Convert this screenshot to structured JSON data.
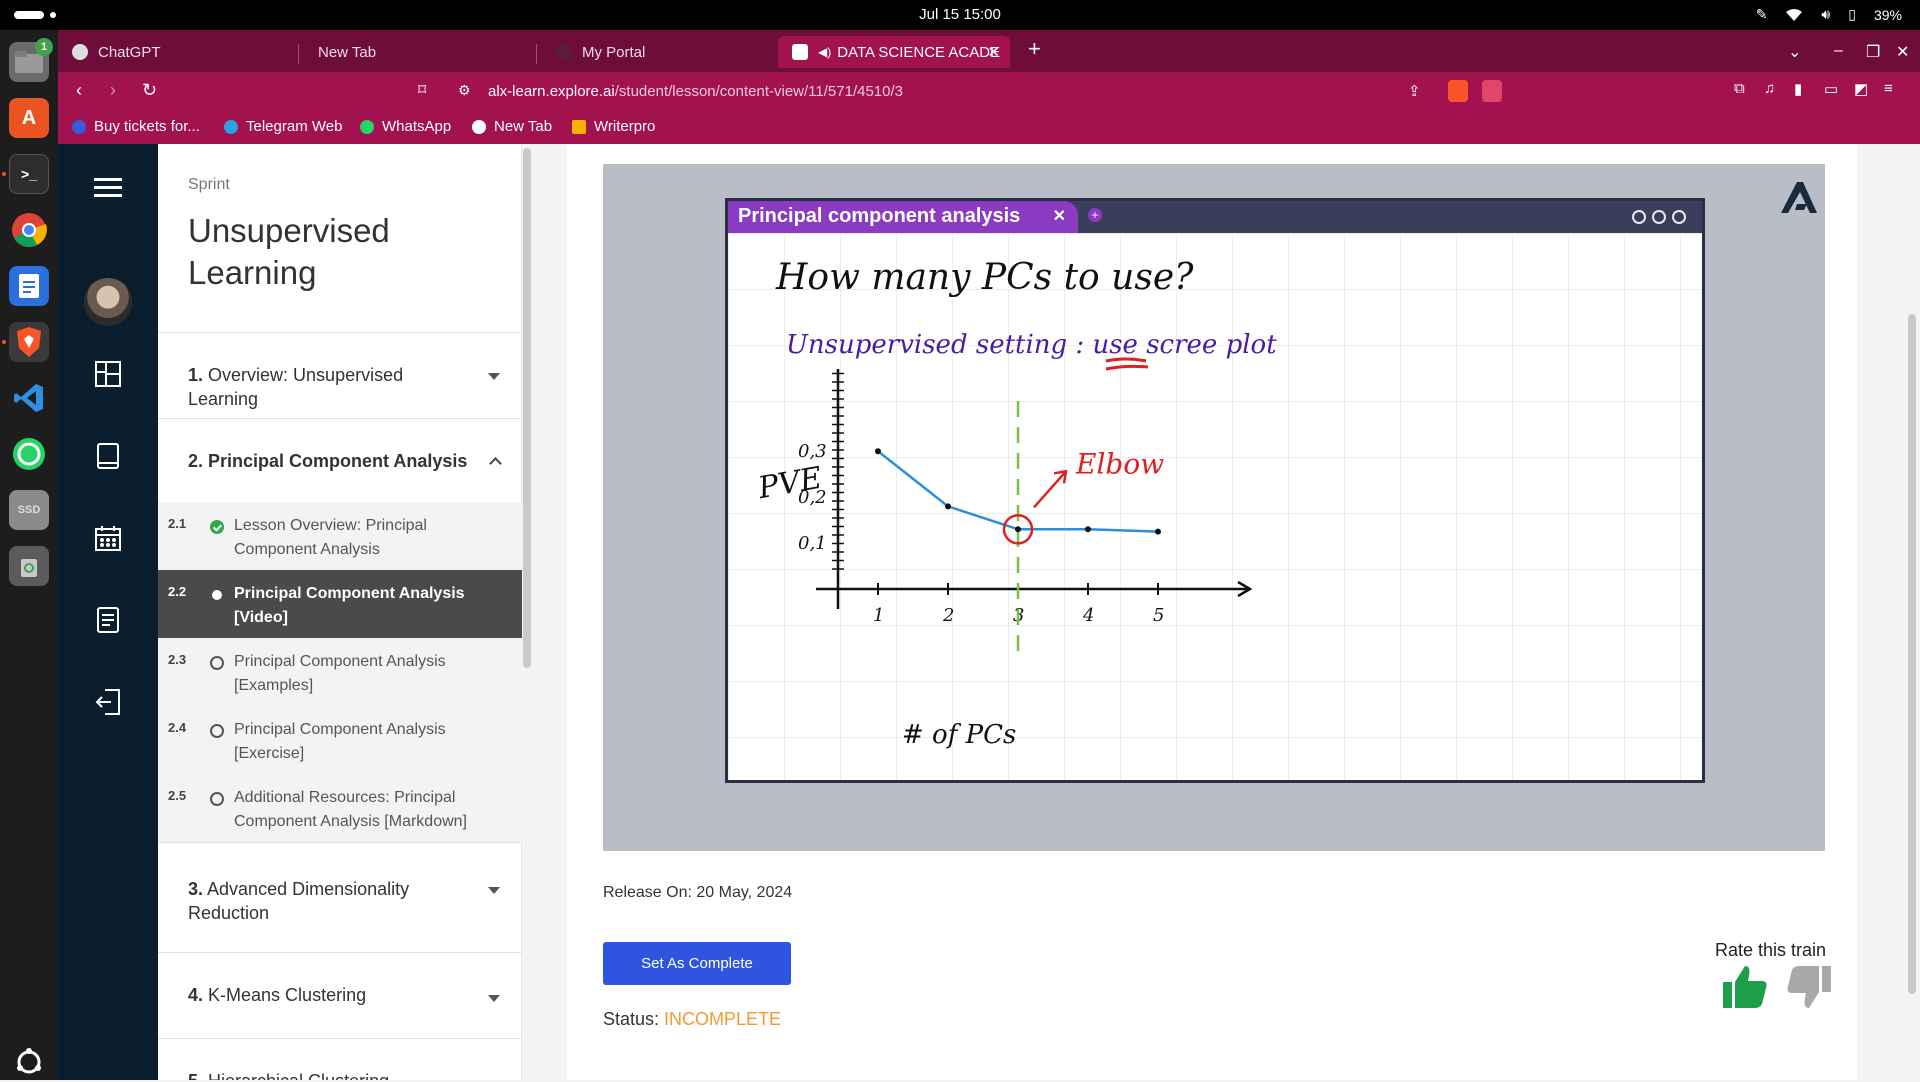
{
  "system": {
    "clock": "Jul 15  15:00",
    "battery": "39%"
  },
  "dock": {
    "files_badge": "1",
    "ssd_label": "SSD"
  },
  "browser": {
    "tabs": [
      {
        "label": "ChatGPT"
      },
      {
        "label": "New Tab"
      },
      {
        "label": "My Portal"
      },
      {
        "label": "DATA SCIENCE ACADE"
      }
    ],
    "url_host": "alx-learn.explore.ai",
    "url_path": "/student/lesson/content-view/11/571/4510/3",
    "bookmarks": [
      {
        "label": "Buy tickets for...",
        "color": "#3b5bdb"
      },
      {
        "label": "Telegram Web",
        "color": "#2aa3e0"
      },
      {
        "label": "WhatsApp",
        "color": "#25d366"
      },
      {
        "label": "New Tab",
        "color": "#ffffff"
      },
      {
        "label": "Writerpro",
        "color": "#f5b100"
      }
    ]
  },
  "sidebar": {
    "sprint_label": "Sprint",
    "course_title": "Unsupervised Learning",
    "sections": [
      {
        "num": "1.",
        "title": "Overview: Unsupervised Learning"
      },
      {
        "num": "2.",
        "title": "Principal Component Analysis"
      },
      {
        "num": "3.",
        "title": "Advanced Dimensionality Reduction"
      },
      {
        "num": "4.",
        "title": "K-Means Clustering"
      },
      {
        "num": "5.",
        "title": "Hierarchical Clustering"
      }
    ],
    "lessons": [
      {
        "num": "2.1",
        "title": "Lesson Overview: Principal Component Analysis",
        "status": "complete"
      },
      {
        "num": "2.2",
        "title": "Principal Component Analysis [Video]",
        "status": "current"
      },
      {
        "num": "2.3",
        "title": "Principal Component Analysis [Examples]",
        "status": "incomplete"
      },
      {
        "num": "2.4",
        "title": "Principal Component Analysis [Exercise]",
        "status": "incomplete"
      },
      {
        "num": "2.5",
        "title": "Additional Resources: Principal Component Analysis [Markdown]",
        "status": "incomplete"
      }
    ]
  },
  "video": {
    "whiteboard_title": "Principal component analysis",
    "whiteboard": {
      "heading": "How many PCs to use?",
      "bullet": "Unsupervised setting : use scree plot",
      "ylabel": "PVE",
      "xlabel": "# of PCs",
      "annotation": "Elbow",
      "y_ticks": [
        "0,3",
        "0,2",
        "0,1"
      ],
      "x_ticks": [
        "1",
        "2",
        "3",
        "4",
        "5"
      ]
    }
  },
  "chart_data": {
    "type": "line",
    "x": [
      1,
      2,
      3,
      4,
      5
    ],
    "values": [
      0.3,
      0.18,
      0.13,
      0.13,
      0.125
    ],
    "xlabel": "# of PCs",
    "ylabel": "PVE",
    "annotation": "Elbow",
    "annotation_x": 3
  },
  "lesson": {
    "release": "Release On: 20 May, 2024",
    "complete_button": "Set As Complete",
    "status_label": "Status:",
    "status_value": "INCOMPLETE",
    "rate_label": "Rate this train"
  },
  "colors": {
    "browser_tabbar": "#6e0c3a",
    "browser_toolbar": "#a1124f",
    "rail": "#0b1e2e",
    "primary_button": "#2f55e0",
    "status_incomplete": "#f39a2d",
    "thumbs_up": "#1e9e4a",
    "thumbs_down": "#a9a9a9",
    "whiteboard_tab": "#8a3bc2"
  }
}
